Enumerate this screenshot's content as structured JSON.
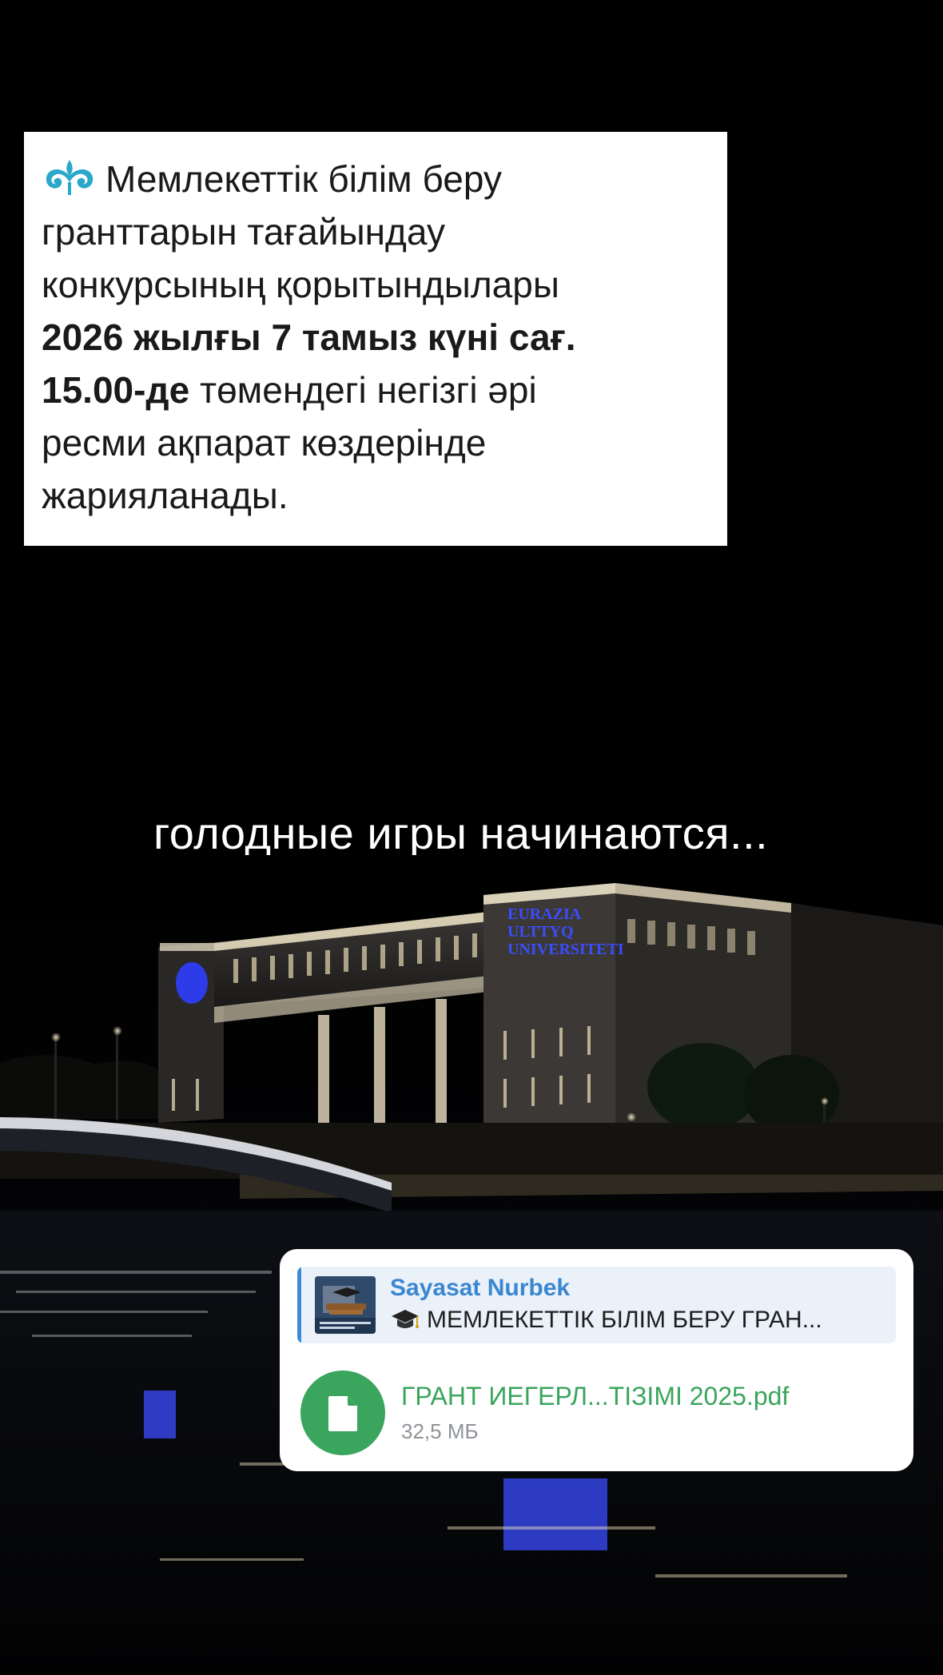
{
  "announcement": {
    "line_intro": "Мемлекеттік білім беру",
    "line2": "гранттарын тағайындау",
    "line3": "конкурсының қорытындылары",
    "bold1": "2026 жылғы 7 тамыз күні сағ.",
    "bold2": "15.00-де",
    "line5_rest": " төмендегі негізгі әрі",
    "line6": "ресми ақпарат көздерінде",
    "line7": "жарияланады.",
    "logo_icon": "ornament-icon",
    "logo_color": "#2aa7c9"
  },
  "caption": "голодные игры начинаются...",
  "photo": {
    "building_sign": [
      "EURAZIA",
      "ULTTYQ",
      "UNIVERSITETI"
    ],
    "sign_color": "#3a4dff"
  },
  "telegram": {
    "reply_name": "Sayasat Nurbek",
    "reply_text": "МЕМЛЕКЕТТІК БІЛІМ БЕРУ ГРАН...",
    "reply_icon": "graduation-cap-icon",
    "file_name": "ГРАНТ ИЕГЕРЛ...ТІЗІМІ 2025.pdf",
    "file_size": "32,5 МБ",
    "file_icon": "document-icon",
    "accent": "#3aa55c",
    "link_color": "#3a87d0"
  }
}
